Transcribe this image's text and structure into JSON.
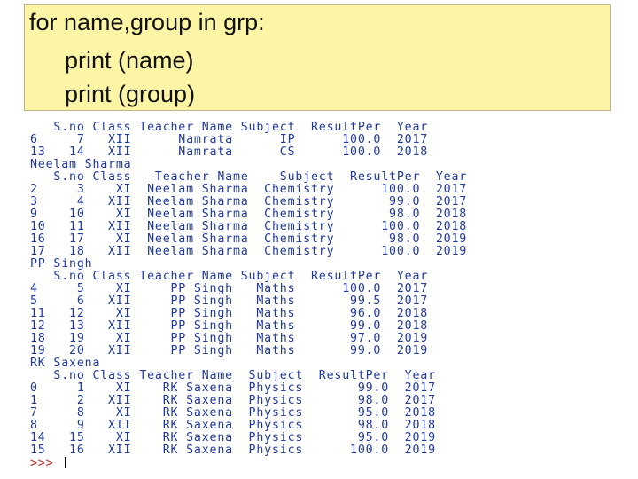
{
  "code": {
    "lines": [
      "for name,group in grp:",
      "print (name)",
      "print (group)"
    ]
  },
  "console": {
    "lines": [
      "   S.no Class Teacher Name Subject  ResultPer  Year",
      "6     7   XII      Namrata      IP      100.0  2017",
      "13   14   XII      Namrata      CS      100.0  2018",
      "Neelam Sharma",
      "   S.no Class   Teacher Name    Subject  ResultPer  Year",
      "2     3    XI  Neelam Sharma  Chemistry      100.0  2017",
      "3     4   XII  Neelam Sharma  Chemistry       99.0  2017",
      "9    10    XI  Neelam Sharma  Chemistry       98.0  2018",
      "10   11   XII  Neelam Sharma  Chemistry      100.0  2018",
      "16   17    XI  Neelam Sharma  Chemistry       98.0  2019",
      "17   18   XII  Neelam Sharma  Chemistry      100.0  2019",
      "PP Singh",
      "   S.no Class Teacher Name Subject  ResultPer  Year",
      "4     5    XI     PP Singh   Maths      100.0  2017",
      "5     6   XII     PP Singh   Maths       99.5  2017",
      "11   12    XI     PP Singh   Maths       96.0  2018",
      "12   13   XII     PP Singh   Maths       99.0  2018",
      "18   19    XI     PP Singh   Maths       97.0  2019",
      "19   20   XII     PP Singh   Maths       99.0  2019",
      "RK Saxena",
      "   S.no Class Teacher Name  Subject  ResultPer  Year",
      "0     1    XI    RK Saxena  Physics       99.0  2017",
      "1     2   XII    RK Saxena  Physics       98.0  2017",
      "7     8    XI    RK Saxena  Physics       95.0  2018",
      "8     9   XII    RK Saxena  Physics       98.0  2018",
      "14   15    XI    RK Saxena  Physics       95.0  2019",
      "15   16   XII    RK Saxena  Physics      100.0  2019"
    ],
    "prompt": ">>> "
  }
}
